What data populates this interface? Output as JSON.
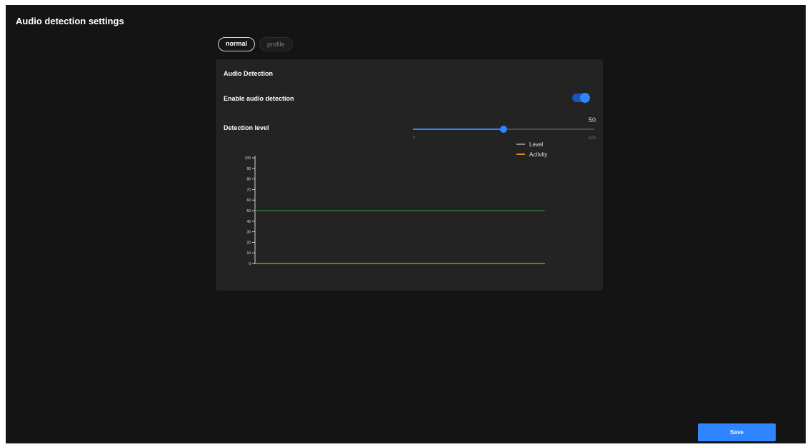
{
  "page": {
    "title": "Audio detection settings"
  },
  "tabs": [
    {
      "label": "normal",
      "active": true
    },
    {
      "label": "profile",
      "active": false
    }
  ],
  "panel": {
    "title": "Audio Detection",
    "enable_label": "Enable audio detection",
    "enabled": true,
    "detection_level_label": "Detection level",
    "detection_level": {
      "value": 50,
      "display": "50",
      "min_label": "0",
      "max_label": "100",
      "min": 0,
      "max": 100
    }
  },
  "chart_data": {
    "type": "line",
    "title": "",
    "xlabel": "",
    "ylabel": "",
    "ylim": [
      0,
      100
    ],
    "yticks": [
      "0",
      "10",
      "20",
      "30",
      "40",
      "50",
      "60",
      "70",
      "80",
      "90",
      "100"
    ],
    "legend_position": "top-right",
    "series": [
      {
        "name": "Level",
        "values": [
          50,
          50
        ],
        "color": "#2d7f2b",
        "legend_color": "#8a8a8a"
      },
      {
        "name": "Activity",
        "values": [
          0,
          0
        ],
        "color": "#d4901c",
        "legend_color": "#d4901c"
      }
    ]
  },
  "actions": {
    "save_label": "Save"
  },
  "colors": {
    "accent": "#2f84ff",
    "background": "#141414",
    "card": "#232323",
    "level_line": "#2d7f2b",
    "activity_line": "#d4901c"
  }
}
